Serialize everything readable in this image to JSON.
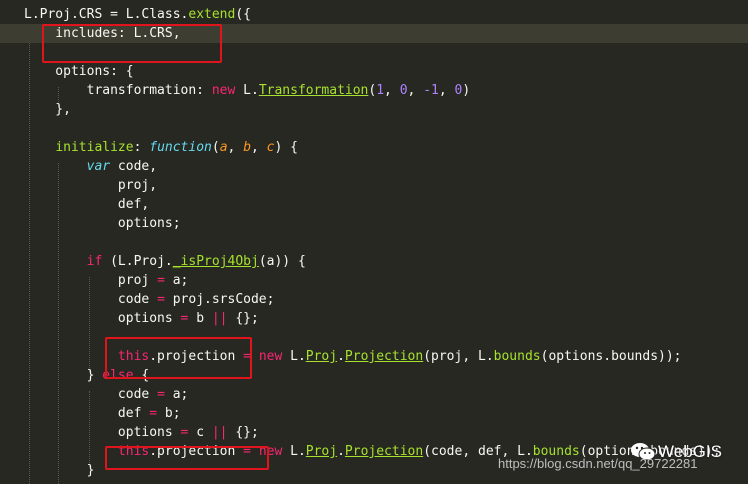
{
  "code_lines": [
    {
      "segments": [
        {
          "text": "L.Proj.CRS = L.Class.",
          "c": ""
        },
        {
          "text": "extend",
          "c": "fn"
        },
        {
          "text": "({",
          "c": ""
        }
      ]
    },
    {
      "segments": [
        {
          "text": "    includes: L.CRS,",
          "c": ""
        }
      ]
    },
    {
      "segments": [
        {
          "text": "",
          "c": ""
        }
      ]
    },
    {
      "segments": [
        {
          "text": "    options: {",
          "c": ""
        }
      ]
    },
    {
      "segments": [
        {
          "text": "        transformation: ",
          "c": ""
        },
        {
          "text": "new",
          "c": "kw"
        },
        {
          "text": " L.",
          "c": ""
        },
        {
          "text": "Transformation",
          "c": "ul"
        },
        {
          "text": "(",
          "c": ""
        },
        {
          "text": "1",
          "c": "num"
        },
        {
          "text": ", ",
          "c": ""
        },
        {
          "text": "0",
          "c": "num"
        },
        {
          "text": ", ",
          "c": ""
        },
        {
          "text": "-1",
          "c": "num"
        },
        {
          "text": ", ",
          "c": ""
        },
        {
          "text": "0",
          "c": "num"
        },
        {
          "text": ")",
          "c": ""
        }
      ]
    },
    {
      "segments": [
        {
          "text": "    },",
          "c": ""
        }
      ]
    },
    {
      "segments": [
        {
          "text": "",
          "c": ""
        }
      ]
    },
    {
      "segments": [
        {
          "text": "    ",
          "c": ""
        },
        {
          "text": "initialize",
          "c": "fn"
        },
        {
          "text": ": ",
          "c": ""
        },
        {
          "text": "function",
          "c": "st"
        },
        {
          "text": "(",
          "c": ""
        },
        {
          "text": "a",
          "c": "arg"
        },
        {
          "text": ", ",
          "c": ""
        },
        {
          "text": "b",
          "c": "arg"
        },
        {
          "text": ", ",
          "c": ""
        },
        {
          "text": "c",
          "c": "arg"
        },
        {
          "text": ") {",
          "c": ""
        }
      ]
    },
    {
      "segments": [
        {
          "text": "        ",
          "c": ""
        },
        {
          "text": "var",
          "c": "st"
        },
        {
          "text": " code,",
          "c": ""
        }
      ]
    },
    {
      "segments": [
        {
          "text": "            proj,",
          "c": ""
        }
      ]
    },
    {
      "segments": [
        {
          "text": "            def,",
          "c": ""
        }
      ]
    },
    {
      "segments": [
        {
          "text": "            options;",
          "c": ""
        }
      ]
    },
    {
      "segments": [
        {
          "text": "",
          "c": ""
        }
      ]
    },
    {
      "segments": [
        {
          "text": "        ",
          "c": ""
        },
        {
          "text": "if",
          "c": "kw"
        },
        {
          "text": " (L.Proj.",
          "c": ""
        },
        {
          "text": "_isProj4Obj",
          "c": "ul"
        },
        {
          "text": "(a)) {",
          "c": ""
        }
      ]
    },
    {
      "segments": [
        {
          "text": "            proj ",
          "c": ""
        },
        {
          "text": "=",
          "c": "kw"
        },
        {
          "text": " a;",
          "c": ""
        }
      ]
    },
    {
      "segments": [
        {
          "text": "            code ",
          "c": ""
        },
        {
          "text": "=",
          "c": "kw"
        },
        {
          "text": " proj.srsCode;",
          "c": ""
        }
      ]
    },
    {
      "segments": [
        {
          "text": "            options ",
          "c": ""
        },
        {
          "text": "=",
          "c": "kw"
        },
        {
          "text": " b ",
          "c": ""
        },
        {
          "text": "||",
          "c": "kw"
        },
        {
          "text": " {};",
          "c": ""
        }
      ]
    },
    {
      "segments": [
        {
          "text": "",
          "c": ""
        }
      ]
    },
    {
      "segments": [
        {
          "text": "            ",
          "c": ""
        },
        {
          "text": "this",
          "c": "kw"
        },
        {
          "text": ".projection ",
          "c": ""
        },
        {
          "text": "=",
          "c": "kw"
        },
        {
          "text": " ",
          "c": ""
        },
        {
          "text": "new",
          "c": "kw"
        },
        {
          "text": " L.",
          "c": ""
        },
        {
          "text": "Proj",
          "c": "ul"
        },
        {
          "text": ".",
          "c": ""
        },
        {
          "text": "Projection",
          "c": "ul"
        },
        {
          "text": "(proj, L.",
          "c": ""
        },
        {
          "text": "bounds",
          "c": "fn"
        },
        {
          "text": "(options.bounds));",
          "c": ""
        }
      ]
    },
    {
      "segments": [
        {
          "text": "        } ",
          "c": ""
        },
        {
          "text": "else",
          "c": "kw"
        },
        {
          "text": " {",
          "c": ""
        }
      ]
    },
    {
      "segments": [
        {
          "text": "            code ",
          "c": ""
        },
        {
          "text": "=",
          "c": "kw"
        },
        {
          "text": " a;",
          "c": ""
        }
      ]
    },
    {
      "segments": [
        {
          "text": "            def ",
          "c": ""
        },
        {
          "text": "=",
          "c": "kw"
        },
        {
          "text": " b;",
          "c": ""
        }
      ]
    },
    {
      "segments": [
        {
          "text": "            options ",
          "c": ""
        },
        {
          "text": "=",
          "c": "kw"
        },
        {
          "text": " c ",
          "c": ""
        },
        {
          "text": "||",
          "c": "kw"
        },
        {
          "text": " {};",
          "c": ""
        }
      ]
    },
    {
      "segments": [
        {
          "text": "            ",
          "c": ""
        },
        {
          "text": "this",
          "c": "kw"
        },
        {
          "text": ".projection ",
          "c": ""
        },
        {
          "text": "=",
          "c": "kw"
        },
        {
          "text": " ",
          "c": ""
        },
        {
          "text": "new",
          "c": "kw"
        },
        {
          "text": " L.",
          "c": ""
        },
        {
          "text": "Proj",
          "c": "ul"
        },
        {
          "text": ".",
          "c": ""
        },
        {
          "text": "Projection",
          "c": "ul"
        },
        {
          "text": "(code, def, L.",
          "c": ""
        },
        {
          "text": "bounds",
          "c": "fn"
        },
        {
          "text": "(options.bounds));",
          "c": ""
        }
      ]
    },
    {
      "segments": [
        {
          "text": "        }",
          "c": ""
        }
      ]
    }
  ],
  "current_line": 1,
  "colors": {
    "background": "#272822",
    "current_line": "#3e3d32",
    "text": "#f8f8f2",
    "keyword": "#f92672",
    "storage": "#66d9ef",
    "function": "#a6e22e",
    "argument": "#fd971f",
    "number": "#ae81ff",
    "annotation_box": "#e0141c"
  },
  "watermark": {
    "icon": "wechat-icon",
    "name": "WebGIS",
    "url": "https://blog.csdn.net/qq_29722281"
  }
}
